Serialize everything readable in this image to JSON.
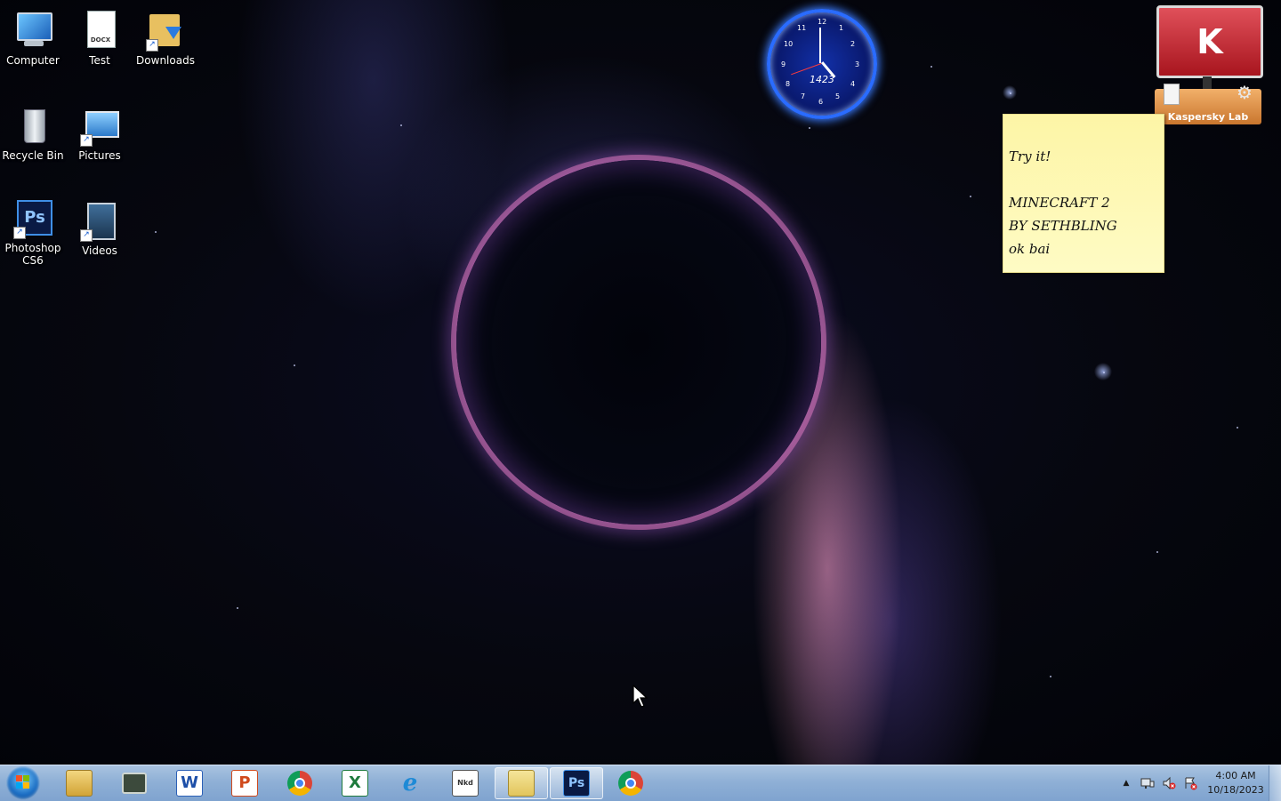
{
  "desktop": {
    "icons": [
      {
        "label": "Computer",
        "icon": "computer-icon"
      },
      {
        "label": "Test",
        "icon": "docx-file-icon",
        "badge": "DOCX"
      },
      {
        "label": "Downloads",
        "icon": "downloads-folder-icon"
      },
      {
        "label": "Recycle Bin",
        "icon": "recycle-bin-icon"
      },
      {
        "label": "Pictures",
        "icon": "pictures-folder-icon"
      },
      {
        "label": "Photoshop CS6",
        "icon": "photoshop-icon",
        "glyph": "Ps"
      },
      {
        "label": "Videos",
        "icon": "videos-folder-icon"
      }
    ]
  },
  "clock_gadget": {
    "numbers": [
      "12",
      "1",
      "2",
      "3",
      "4",
      "5",
      "6",
      "7",
      "8",
      "9",
      "10",
      "11"
    ],
    "readout": "1423"
  },
  "kaspersky_gadget": {
    "logo": "K",
    "label": "Kaspersky Lab",
    "icon": "kaspersky-icon"
  },
  "sticky_note": {
    "lines": [
      "Try it!",
      "",
      "MINECRAFT 2",
      "BY SETHBLING",
      "ok bai"
    ]
  },
  "taskbar": {
    "start_icon": "windows-start-icon",
    "apps": [
      {
        "name": "Windows Explorer",
        "icon": "explorer-icon",
        "glyph": "",
        "active": false
      },
      {
        "name": "Computer Monitor",
        "icon": "monitor-icon",
        "glyph": "",
        "active": false
      },
      {
        "name": "Microsoft Word",
        "icon": "word-icon",
        "glyph": "W",
        "active": false
      },
      {
        "name": "Microsoft PowerPoint",
        "icon": "powerpoint-icon",
        "glyph": "P",
        "active": false
      },
      {
        "name": "Google Chrome",
        "icon": "chrome-icon",
        "glyph": "",
        "active": false
      },
      {
        "name": "Microsoft Excel",
        "icon": "excel-icon",
        "glyph": "X",
        "active": false
      },
      {
        "name": "Internet Explorer",
        "icon": "ie-icon",
        "glyph": "e",
        "active": false
      },
      {
        "name": "Notepad",
        "icon": "notepad-icon",
        "glyph": "Nkd",
        "active": false
      },
      {
        "name": "Folder",
        "icon": "folder-icon",
        "glyph": "",
        "active": true
      },
      {
        "name": "Photoshop",
        "icon": "photoshop-icon",
        "glyph": "Ps",
        "active": true
      },
      {
        "name": "Google Chrome",
        "icon": "chrome-icon",
        "glyph": "",
        "active": false
      }
    ],
    "tray": {
      "icons": [
        "show-hidden-icons-chevron-icon",
        "network-icon",
        "volume-muted-icon",
        "action-center-icon"
      ],
      "chevron": "▲",
      "time": "4:00 AM",
      "date": "10/18/2023"
    }
  },
  "colors": {
    "taskbar": "#8fb0d6",
    "sticky": "#fdf5a6",
    "kaspersky_red": "#c0262f",
    "clock_blue": "#2a6cff"
  }
}
